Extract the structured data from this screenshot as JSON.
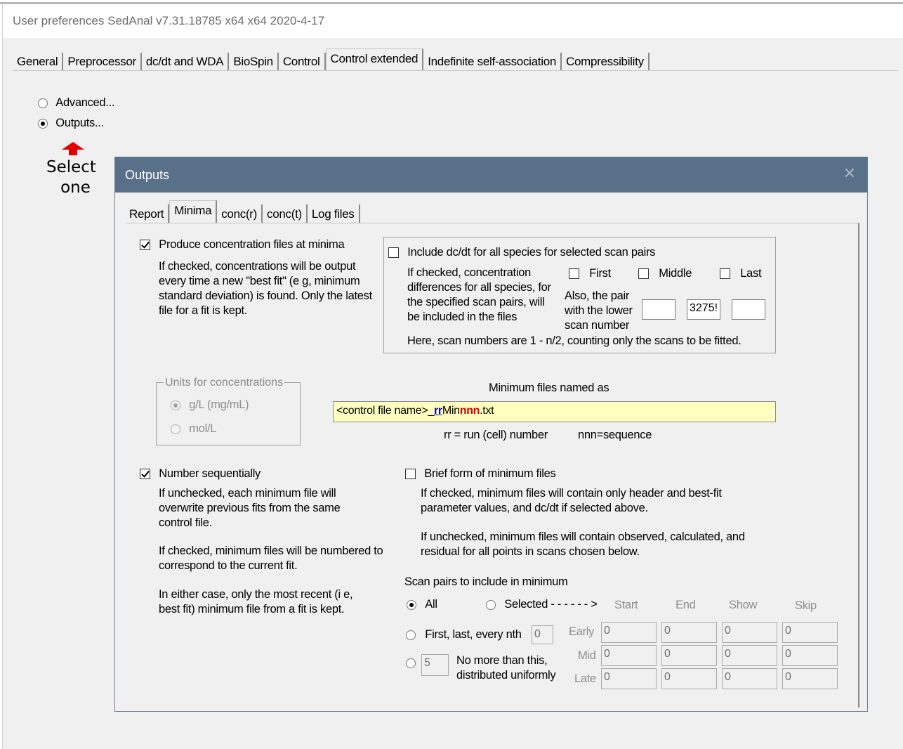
{
  "window": {
    "title": "User preferences  SedAnal v7.31.18785 x64 x64 2020-4-17"
  },
  "tabs": [
    "General",
    "Preprocessor",
    "dc/dt and WDA",
    "BioSpin",
    "Control",
    "Control extended",
    "Indefinite self-association",
    "Compressibility"
  ],
  "mode": {
    "advanced_label": "Advanced...",
    "outputs_label": "Outputs...",
    "selected": "Outputs..."
  },
  "annotation": {
    "line1": "Select",
    "line2": "one"
  },
  "dialog": {
    "title": "Outputs",
    "close": "✕",
    "tabs": [
      "Report",
      "Minima",
      "conc(r)",
      "conc(t)",
      "Log files"
    ],
    "active_tab": "Minima"
  },
  "minima": {
    "produce": {
      "label": "Produce concentration files at minima",
      "checked": true,
      "desc": "If checked, concentrations will be output every time a new \"best fit\" (e g, minimum standard deviation) is found. Only the latest file for a fit is kept."
    },
    "dcdt": {
      "label": "Include dc/dt for all species for selected scan pairs",
      "checked": false,
      "desc": "If checked, concentration differences for all species, for the specified scan pairs, will be included in the files",
      "first": "First",
      "middle": "Middle",
      "last": "Last",
      "pair_label": "Also, the pair with the lower scan number",
      "pair_values": [
        "",
        "3275!",
        ""
      ],
      "note": "Here, scan numbers are 1 - n/2, counting only the scans to be fitted."
    },
    "units": {
      "title": "Units for concentrations",
      "gl": "g/L (mg/mL)",
      "moll": "mol/L",
      "selected": "g/L (mg/mL)"
    },
    "naming": {
      "title": "Minimum files named as",
      "prefix": "<control file name>_",
      "rr": "rr",
      "min": "Min",
      "nnn": "nnn",
      "suffix": ".txt",
      "legend_rr": "rr = run (cell) number",
      "legend_nnn": "nnn=sequence"
    },
    "sequential": {
      "label": "Number sequentially",
      "checked": true,
      "desc1": "If unchecked, each minimum file will overwrite previous fits from the same control file.",
      "desc2": "If checked, minimum files will be numbered to correspond to the current fit.",
      "desc3": "In either case, only the most recent (i e, best fit) minimum file from a fit is kept."
    },
    "brief": {
      "label": "Brief form of minimum files",
      "checked": false,
      "desc1": "If checked, minimum files will contain only header and best-fit parameter values, and dc/dt if selected above.",
      "desc2": "If unchecked, minimum files will contain observed, calculated, and residual for all points in scans chosen below."
    },
    "scanpairs": {
      "title": "Scan pairs to include in minimum",
      "all": "All",
      "selected": "Selected - - - - - - >",
      "first_last": "First, last, every nth",
      "nth_value": "0",
      "nomore_value": "5",
      "nomore": "No more than this, distributed uniformly",
      "chosen": "All",
      "cols": [
        "Start",
        "End",
        "Show",
        "Skip"
      ],
      "rows": [
        {
          "label": "Early",
          "values": [
            "0",
            "0",
            "0",
            "0"
          ]
        },
        {
          "label": "Mid",
          "values": [
            "0",
            "0",
            "0",
            "0"
          ]
        },
        {
          "label": "Late",
          "values": [
            "0",
            "0",
            "0",
            "0"
          ]
        }
      ]
    }
  }
}
